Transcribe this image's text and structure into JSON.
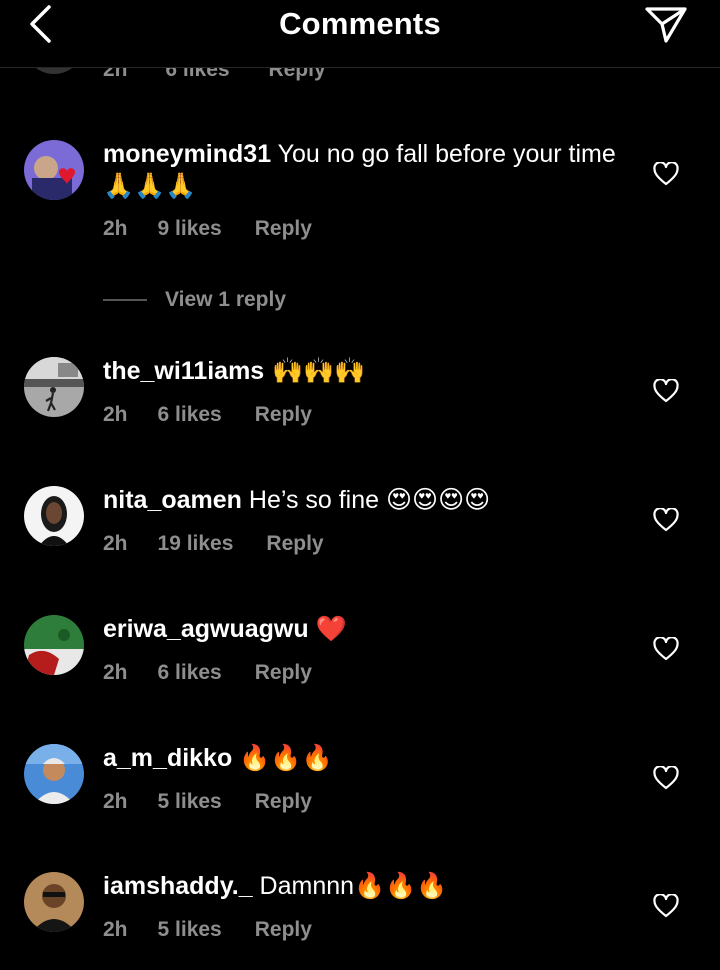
{
  "header": {
    "title": "Comments"
  },
  "partial": {
    "time": "2h",
    "likes": "6 likes",
    "reply": "Reply"
  },
  "comments": [
    {
      "username": "moneymind31",
      "text": " You no go fall before your time",
      "emoji": " 🙏🙏🙏",
      "time": "2h",
      "likes": "9 likes",
      "reply": "Reply",
      "avatar_color": "#7a6bd6"
    },
    {
      "username": "the_wi11iams",
      "text": "",
      "emoji": " 🙌🙌🙌",
      "time": "2h",
      "likes": "6 likes",
      "reply": "Reply",
      "avatar_color": "#9a9a9a"
    },
    {
      "username": "nita_oamen",
      "text": " He’s so fine ",
      "emoji": "😍😍😍😍",
      "time": "2h",
      "likes": "19 likes",
      "reply": "Reply",
      "avatar_color": "#3a2a22"
    },
    {
      "username": "eriwa_agwuagwu",
      "text": " ",
      "emoji": "❤️",
      "time": "2h",
      "likes": "6 likes",
      "reply": "Reply",
      "avatar_color": "#2f7d3a"
    },
    {
      "username": "a_m_dikko",
      "text": " ",
      "emoji": "🔥🔥🔥",
      "time": "2h",
      "likes": "5 likes",
      "reply": "Reply",
      "avatar_color": "#4a8bd8"
    },
    {
      "username": "iamshaddy._",
      "text": " Damnnn",
      "emoji": "🔥🔥🔥",
      "time": "2h",
      "likes": "5 likes",
      "reply": "Reply",
      "avatar_color": "#b58a5a"
    }
  ],
  "view_reply": "View 1 reply",
  "colors": {
    "background": "#000000",
    "muted": "#8e8e8e",
    "text": "#ffffff"
  },
  "icons": [
    "back-chevron-icon",
    "send-paper-plane-icon",
    "heart-outline-icon"
  ]
}
